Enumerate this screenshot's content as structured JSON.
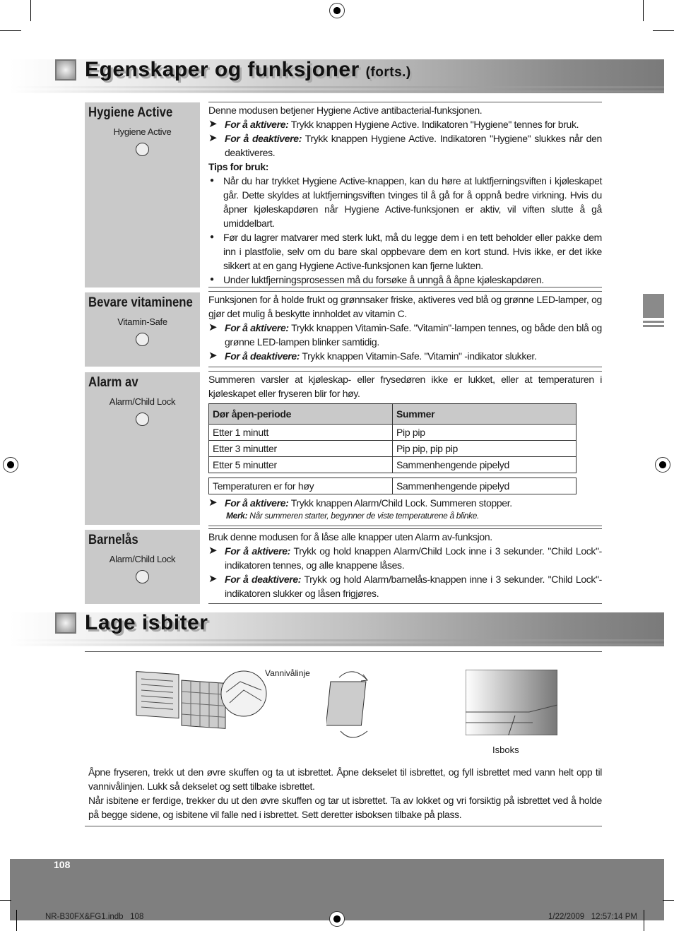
{
  "header": {
    "title": "Egenskaper og funksjoner",
    "suffix": "(forts.)"
  },
  "sections": [
    {
      "label": "Hygiene Active",
      "button": "Hygiene Active",
      "intro": "Denne modusen betjener Hygiene Active antibacterial-funksjonen.",
      "activate_label": "For å aktivere:",
      "activate": " Trykk knappen Hygiene Active. Indikatoren \"Hygiene\" tennes for bruk.",
      "deactivate_label": "For å deaktivere:",
      "deactivate": " Trykk knappen Hygiene Active. Indikatoren \"Hygiene\" slukkes når den deaktiveres.",
      "tips_title": "Tips for bruk:",
      "tips": [
        "Når du har trykket Hygiene Active-knappen, kan du høre at luktfjerningsviften i kjøleskapet går. Dette skyldes at luktfjerningsviften tvinges til å gå for å oppnå bedre virkning. Hvis du åpner kjøleskapdøren når Hygiene Active-funksjonen er aktiv, vil viften slutte å gå umiddelbart.",
        "Før du lagrer matvarer med sterk lukt, må du legge dem i en tett beholder eller pakke dem inn i plastfolie, selv om du bare skal oppbevare dem en kort stund. Hvis ikke, er det ikke sikkert at en gang Hygiene Active-funksjonen kan fjerne lukten.",
        "Under luktfjerningsprosessen må du forsøke å unngå å åpne kjøleskapdøren."
      ]
    },
    {
      "label": "Bevare vitaminene",
      "button": "Vitamin-Safe",
      "intro": "Funksjonen for å holde frukt og grønnsaker friske, aktiveres ved blå og grønne LED-lamper, og gjør det mulig å beskytte innholdet av vitamin C.",
      "activate_label": "For å aktivere:",
      "activate": " Trykk knappen Vitamin-Safe. \"Vitamin\"-lampen tennes, og både den blå og grønne LED-lampen blinker samtidig.",
      "deactivate_label": "For å deaktivere:",
      "deactivate": " Trykk knappen Vitamin-Safe. \"Vitamin\" -indikator slukker."
    },
    {
      "label": "Alarm av",
      "button": "Alarm/Child Lock",
      "intro": "Summeren varsler at kjøleskap- eller frysedøren ikke er lukket, eller at temperaturen i kjøleskapet eller fryseren blir for høy.",
      "table": {
        "headers": [
          "Dør åpen-periode",
          "Summer"
        ],
        "rows": [
          [
            "Etter 1 minutt",
            "Pip pip"
          ],
          [
            "Etter 3 minutter",
            "Pip pip, pip pip"
          ],
          [
            "Etter 5 minutter",
            "Sammenhengende pipelyd"
          ]
        ],
        "extra": [
          "Temperaturen er for høy",
          "Sammenhengende pipelyd"
        ]
      },
      "activate_label": "For å aktivere:",
      "activate": " Trykk knappen Alarm/Child Lock. Summeren stopper.",
      "note_label": "Merk:",
      "note": " Når summeren starter, begynner de viste temperaturene å blinke."
    },
    {
      "label": "Barnelås",
      "button": "Alarm/Child Lock",
      "intro": "Bruk denne modusen for å låse alle knapper uten Alarm av-funksjon.",
      "activate_label": "For å aktivere:",
      "activate": " Trykk og hold knappen Alarm/Child Lock inne i 3 sekunder. \"Child Lock\"-indikatoren tennes, og alle knappene låses.",
      "deactivate_label": "For å deaktivere:",
      "deactivate": " Trykk og hold Alarm/barnelås-knappen inne i 3 sekunder. \"Child Lock\"-indikatoren slukker og låsen frigjøres."
    }
  ],
  "ice": {
    "title": "Lage isbiter",
    "water_line": "Vannivålinje",
    "icebox": "Isboks",
    "paragraphs": [
      "Åpne fryseren, trekk ut den øvre skuffen og ta ut isbrettet. Åpne dekselet til isbrettet, og fyll isbrettet med vann helt opp til vannivålinjen. Lukk så dekselet og sett tilbake isbrettet.",
      "Når isbitene er ferdige, trekker du ut den øvre skuffen og tar ut isbrettet. Ta av lokket og vri forsiktig på isbrettet ved å holde på begge sidene, og isbitene vil falle ned i isbrettet. Sett deretter isboksen tilbake på plass."
    ]
  },
  "footer": {
    "page": "108",
    "file": "NR-B30FX&FG1.indb   108",
    "timestamp": "1/22/2009   12:57:14 PM"
  },
  "colors": {
    "band": "#7f7f7f",
    "label_bg": "#c9c9c9"
  }
}
